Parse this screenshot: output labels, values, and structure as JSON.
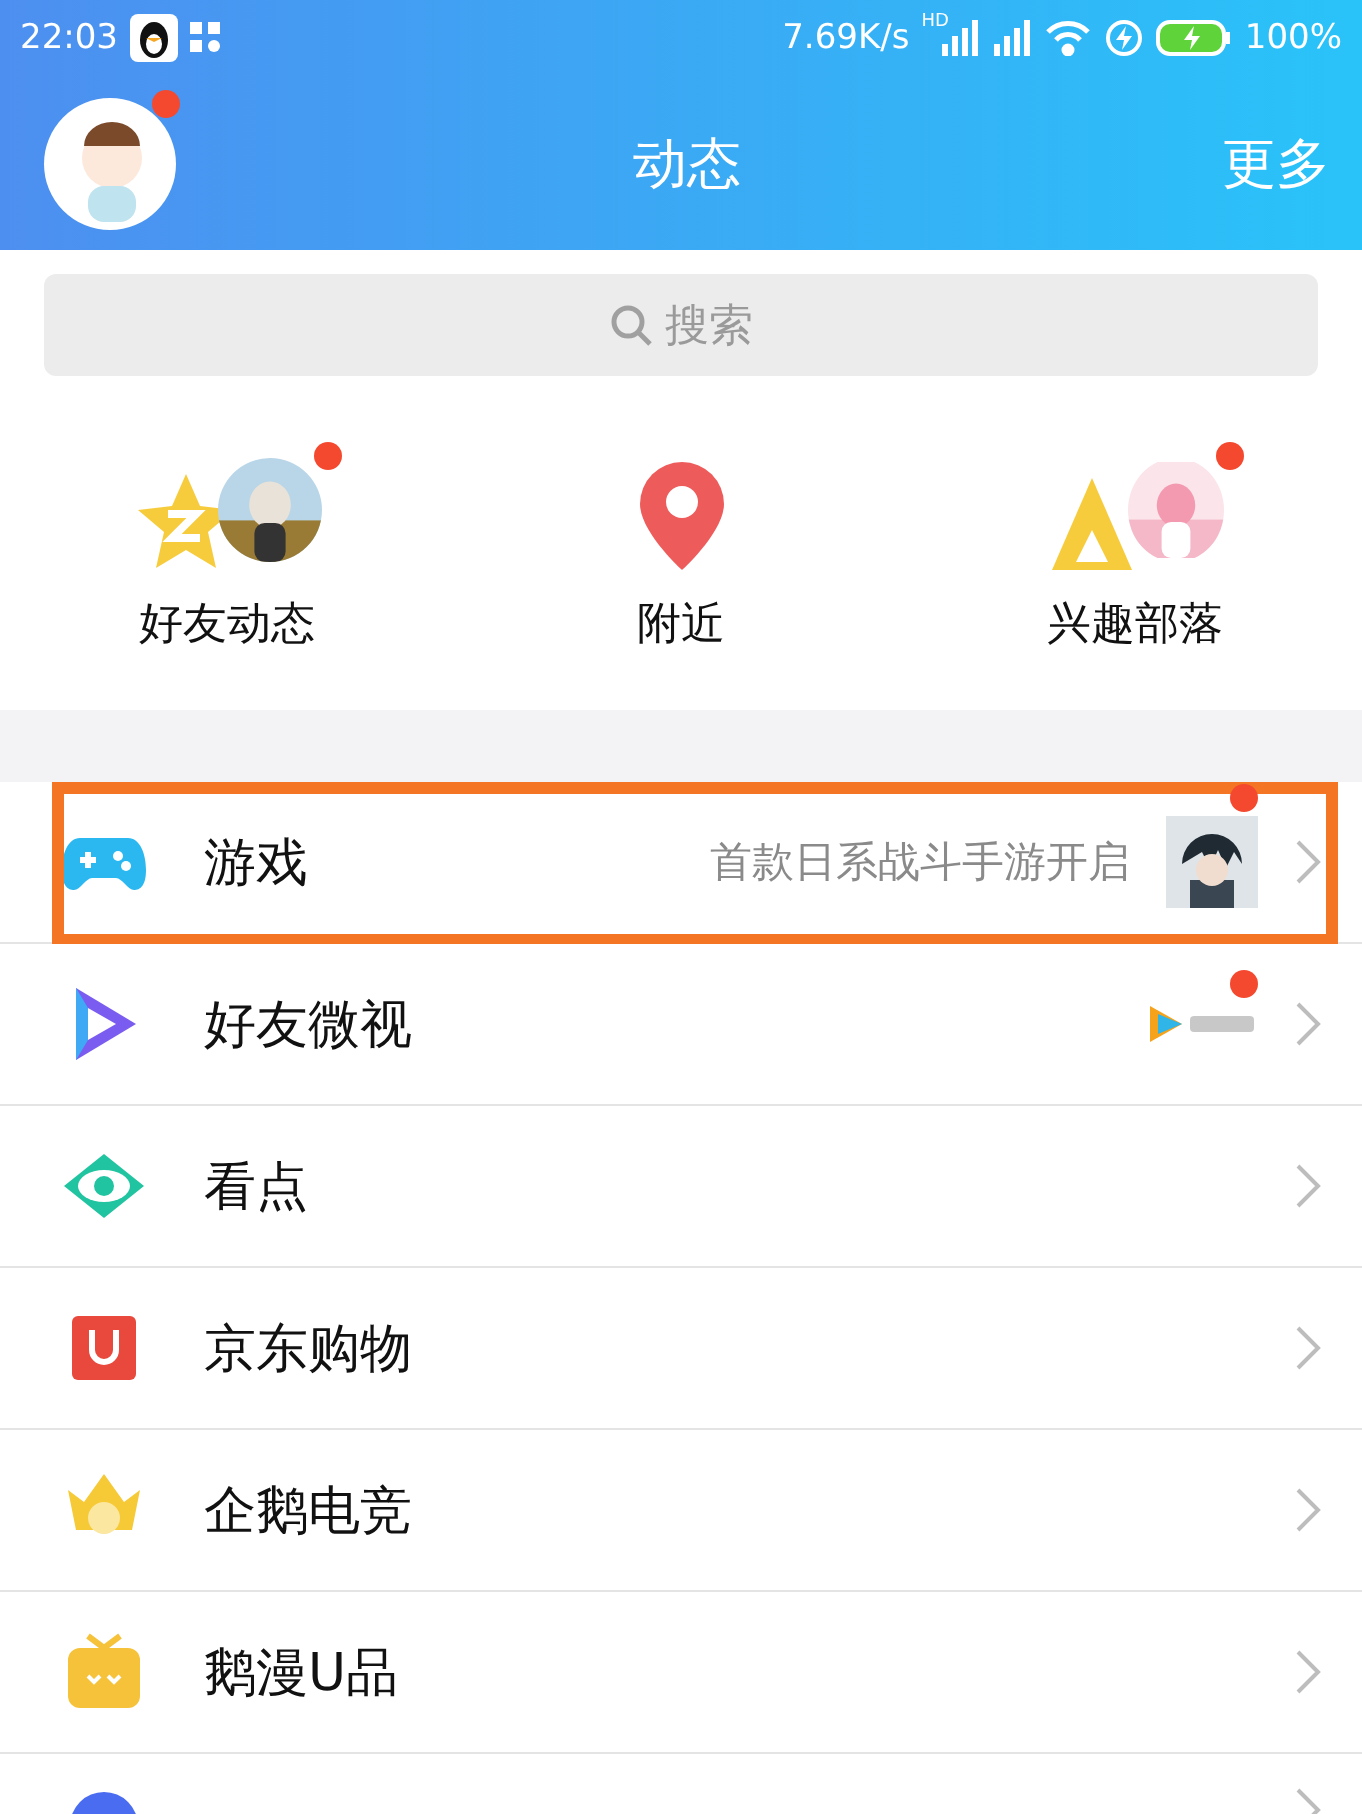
{
  "status_bar": {
    "time": "22:03",
    "speed": "7.69K/s",
    "network_mark": "HD",
    "battery": "100%"
  },
  "header": {
    "title": "动态",
    "more": "更多",
    "avatar_badge": true
  },
  "search": {
    "placeholder": "搜索"
  },
  "shortcuts": [
    {
      "kind": "friends",
      "label": "好友动态",
      "badge": true
    },
    {
      "kind": "nearby",
      "label": "附近",
      "badge": false
    },
    {
      "kind": "tribe",
      "label": "兴趣部落",
      "badge": true
    }
  ],
  "rows": [
    {
      "kind": "game",
      "label": "游戏",
      "subtitle": "首款日系战斗手游开启",
      "badge": true,
      "highlighted": true
    },
    {
      "kind": "weishi",
      "label": "好友微视",
      "thumb": {
        "kind": "video-logo"
      },
      "badge": true,
      "highlighted": false
    },
    {
      "kind": "kandian",
      "label": "看点",
      "badge": false,
      "highlighted": false
    },
    {
      "kind": "jd",
      "label": "京东购物",
      "badge": false,
      "highlighted": false
    },
    {
      "kind": "esports",
      "label": "企鹅电竞",
      "badge": false,
      "highlighted": false
    },
    {
      "kind": "manga",
      "label": "鹅漫U品",
      "badge": false,
      "highlighted": false
    },
    {
      "kind": "circle",
      "badge": false,
      "highlighted": false
    }
  ]
}
